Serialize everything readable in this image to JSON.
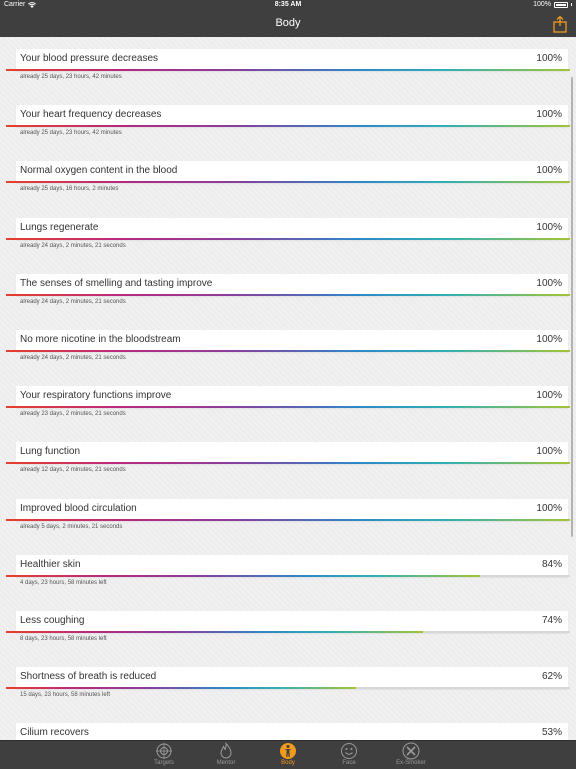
{
  "status_bar": {
    "carrier": "Carrier",
    "time": "8:35 AM",
    "battery": "100%"
  },
  "nav": {
    "title": "Body"
  },
  "items": [
    {
      "title": "Your blood pressure decreases",
      "percent": "100%",
      "progress": 1.0,
      "subtitle": "already 25 days, 23 hours, 42 minutes"
    },
    {
      "title": "Your heart frequency decreases",
      "percent": "100%",
      "progress": 1.0,
      "subtitle": "already 25 days, 23 hours, 42 minutes"
    },
    {
      "title": "Normal oxygen content in the blood",
      "percent": "100%",
      "progress": 1.0,
      "subtitle": "already 25 days, 16 hours, 2 minutes"
    },
    {
      "title": "Lungs regenerate",
      "percent": "100%",
      "progress": 1.0,
      "subtitle": "already 24 days, 2 minutes, 21 seconds"
    },
    {
      "title": "The senses of smelling and tasting improve",
      "percent": "100%",
      "progress": 1.0,
      "subtitle": "already 24 days, 2 minutes, 21 seconds"
    },
    {
      "title": "No more nicotine in the bloodstream",
      "percent": "100%",
      "progress": 1.0,
      "subtitle": "already 24 days, 2 minutes, 21 seconds"
    },
    {
      "title": "Your respiratory functions improve",
      "percent": "100%",
      "progress": 1.0,
      "subtitle": "already 23 days, 2 minutes, 21 seconds"
    },
    {
      "title": "Lung function",
      "percent": "100%",
      "progress": 1.0,
      "subtitle": "already 12 days, 2 minutes, 21 seconds"
    },
    {
      "title": "Improved blood circulation",
      "percent": "100%",
      "progress": 1.0,
      "subtitle": "already 5 days, 2 minutes, 21 seconds"
    },
    {
      "title": "Healthier skin",
      "percent": "84%",
      "progress": 0.84,
      "subtitle": "4 days, 23 hours, 58 minutes left"
    },
    {
      "title": "Less coughing",
      "percent": "74%",
      "progress": 0.74,
      "subtitle": "8 days, 23 hours, 58 minutes left"
    },
    {
      "title": "Shortness of breath is reduced",
      "percent": "62%",
      "progress": 0.62,
      "subtitle": "15 days, 23 hours, 58 minutes left"
    },
    {
      "title": "Cilium recovers",
      "percent": "53%",
      "progress": 0.53,
      "subtitle": ""
    }
  ],
  "tabs": [
    {
      "label": "Targets",
      "icon": "crosshair-icon"
    },
    {
      "label": "Mentor",
      "icon": "flame-icon"
    },
    {
      "label": "Body",
      "icon": "body-icon"
    },
    {
      "label": "Face",
      "icon": "smiley-icon"
    },
    {
      "label": "Ex-Smoker",
      "icon": "tools-icon"
    }
  ],
  "colors": {
    "bar_background": "#3f3f3f",
    "active_tab": "#f29a1e",
    "inactive_tab": "#9a9a9a"
  }
}
